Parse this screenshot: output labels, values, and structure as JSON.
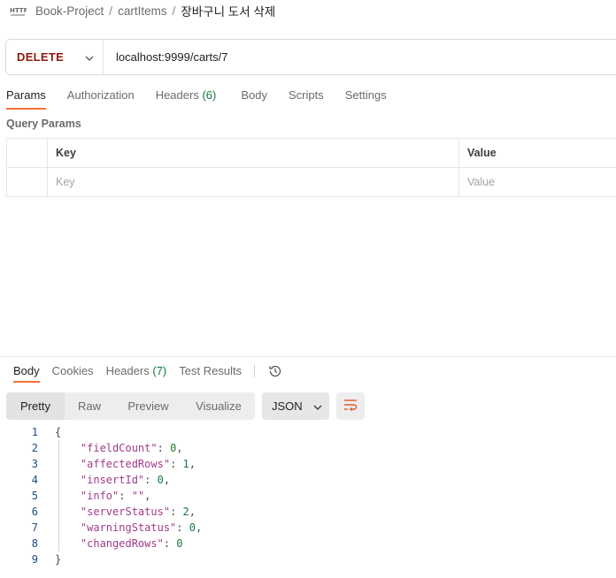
{
  "breadcrumb": {
    "collection": "Book-Project",
    "folder": "cartItems",
    "request": "장바구니 도서 삭제",
    "separator": "/"
  },
  "request": {
    "method": "DELETE",
    "url": "localhost:9999/carts/7"
  },
  "request_tabs": [
    {
      "label": "Params",
      "count": ""
    },
    {
      "label": "Authorization",
      "count": ""
    },
    {
      "label": "Headers",
      "count": "(6)"
    },
    {
      "label": "Body",
      "count": ""
    },
    {
      "label": "Scripts",
      "count": ""
    },
    {
      "label": "Settings",
      "count": ""
    }
  ],
  "query_params": {
    "title": "Query Params",
    "columns": {
      "key": "Key",
      "value": "Value"
    },
    "placeholder": {
      "key": "Key",
      "value": "Value"
    }
  },
  "response_tabs": [
    {
      "label": "Body",
      "count": ""
    },
    {
      "label": "Cookies",
      "count": ""
    },
    {
      "label": "Headers",
      "count": "(7)"
    },
    {
      "label": "Test Results",
      "count": ""
    }
  ],
  "view_modes": [
    "Pretty",
    "Raw",
    "Preview",
    "Visualize"
  ],
  "format": "JSON",
  "response_body": {
    "line_numbers": [
      "1",
      "2",
      "3",
      "4",
      "5",
      "6",
      "7",
      "8",
      "9"
    ],
    "open_brace": "{",
    "close_brace": "}",
    "fields": [
      {
        "key": "\"fieldCount\"",
        "value": "0",
        "type": "number",
        "comma": ","
      },
      {
        "key": "\"affectedRows\"",
        "value": "1",
        "type": "number",
        "comma": ","
      },
      {
        "key": "\"insertId\"",
        "value": "0",
        "type": "number",
        "comma": ","
      },
      {
        "key": "\"info\"",
        "value": "\"\"",
        "type": "string",
        "comma": ","
      },
      {
        "key": "\"serverStatus\"",
        "value": "2",
        "type": "number",
        "comma": ","
      },
      {
        "key": "\"warningStatus\"",
        "value": "0",
        "type": "number",
        "comma": ","
      },
      {
        "key": "\"changedRows\"",
        "value": "0",
        "type": "number",
        "comma": ""
      }
    ]
  },
  "colors": {
    "method": "#8e1a10",
    "active_tab_underline": "#ff6c37",
    "count": "#0f7a3c",
    "json_key": "#a23b8a",
    "json_number": "#1b7a3a"
  }
}
